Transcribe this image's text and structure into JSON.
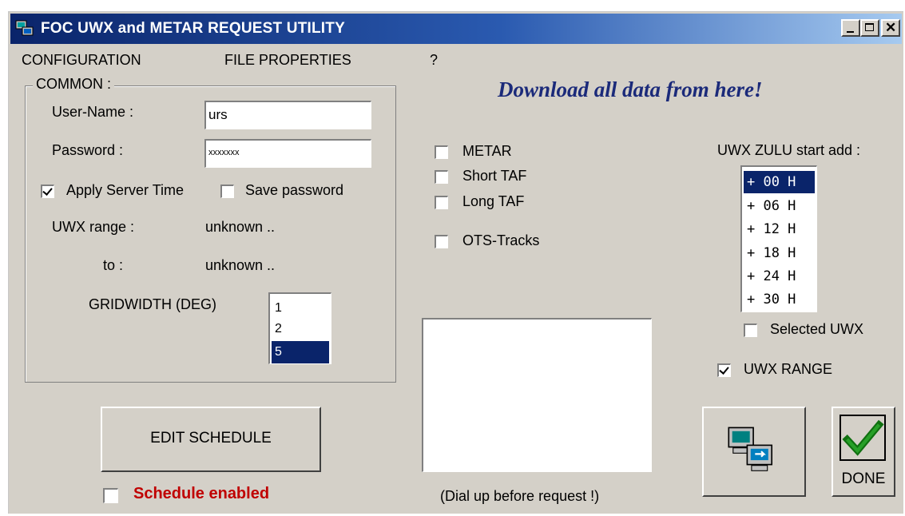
{
  "window": {
    "title": "FOC UWX and METAR REQUEST UTILITY"
  },
  "menu": {
    "items": [
      "CONFIGURATION",
      "FILE PROPERTIES",
      "?"
    ]
  },
  "common": {
    "group_label": "COMMON :",
    "username_label": "User-Name :",
    "username_value": "urs",
    "password_label": "Password :",
    "password_value": "xxxxxxx",
    "apply_server_time": "Apply Server Time",
    "apply_server_time_checked": true,
    "save_password": "Save password",
    "save_password_checked": false,
    "uwx_range_label": "UWX range :",
    "uwx_range_from": "unknown ..",
    "to_label": "to :",
    "uwx_range_to": "unknown ..",
    "gridwidth_label": "GRIDWIDTH (DEG)",
    "gridwidth_options": [
      "1",
      "2",
      "5"
    ],
    "gridwidth_selected": "5"
  },
  "schedule": {
    "edit_button": "EDIT SCHEDULE",
    "enabled_label": "Schedule enabled",
    "enabled_checked": false
  },
  "headline": "Download all  data from here!",
  "request_types": {
    "metar": "METAR",
    "short_taf": "Short TAF",
    "long_taf": "Long TAF",
    "ots_tracks": "OTS-Tracks"
  },
  "dial_note": "(Dial up before request !)",
  "uwx": {
    "zulu_label": "UWX ZULU start add :",
    "zulu_options": [
      "+ 00 H",
      "+ 06 H",
      "+ 12 H",
      "+ 18 H",
      "+ 24 H",
      "+ 30 H"
    ],
    "zulu_selected": "+ 00 H",
    "selected_uwx_label": "Selected UWX",
    "selected_uwx_checked": false,
    "uwx_range_label": "UWX RANGE",
    "uwx_range_checked": true
  },
  "buttons": {
    "done": "DONE"
  },
  "icons": {
    "app": "network-computers-icon",
    "request": "computers-transfer-icon",
    "done": "green-checkmark-icon"
  }
}
